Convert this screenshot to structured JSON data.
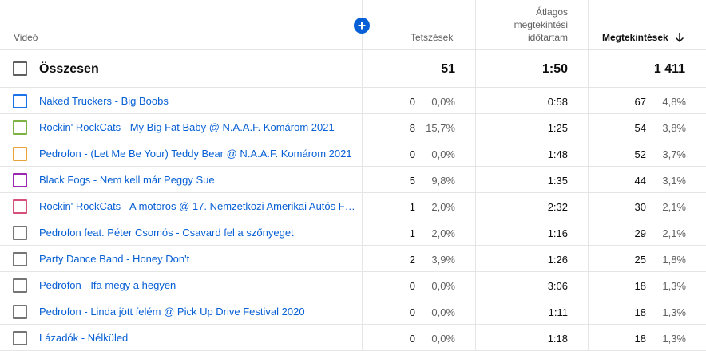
{
  "header": {
    "video_label": "Videó",
    "likes_label": "Tetszések",
    "avg_duration_label_l1": "Átlagos",
    "avg_duration_label_l2": "megtekintési",
    "avg_duration_label_l3": "időtartam",
    "views_label": "Megtekintések",
    "add_icon": "plus-circle-icon",
    "sort_icon": "arrow-down-icon",
    "accent_color": "#065fd4"
  },
  "total": {
    "label": "Összesen",
    "likes": "51",
    "avg_duration": "1:50",
    "views": "1 411"
  },
  "rows": [
    {
      "title": "Naked Truckers - Big Boobs",
      "color": "#1a73e8",
      "likes": "0",
      "likes_pct": "0,0%",
      "avg_duration": "0:58",
      "views": "67",
      "views_pct": "4,8%"
    },
    {
      "title": "Rockin' RockCats - My Big Fat Baby @ N.A.A.F. Komárom 2021",
      "color": "#7cb342",
      "likes": "8",
      "likes_pct": "15,7%",
      "avg_duration": "1:25",
      "views": "54",
      "views_pct": "3,8%"
    },
    {
      "title": "Pedrofon - (Let Me Be Your) Teddy Bear @ N.A.A.F. Komárom 2021",
      "color": "#e8a33d",
      "likes": "0",
      "likes_pct": "0,0%",
      "avg_duration": "1:48",
      "views": "52",
      "views_pct": "3,7%"
    },
    {
      "title": "Black Fogs - Nem kell már Peggy Sue",
      "color": "#9c27b0",
      "likes": "5",
      "likes_pct": "9,8%",
      "avg_duration": "1:35",
      "views": "44",
      "views_pct": "3,1%"
    },
    {
      "title": "Rockin' RockCats - A motoros @ 17. Nemzetközi Amerikai Autós Fe...",
      "color": "#d6507a",
      "likes": "1",
      "likes_pct": "2,0%",
      "avg_duration": "2:32",
      "views": "30",
      "views_pct": "2,1%"
    },
    {
      "title": "Pedrofon feat. Péter Csomós - Csavard fel a szőnyeget",
      "color": "#757575",
      "likes": "1",
      "likes_pct": "2,0%",
      "avg_duration": "1:16",
      "views": "29",
      "views_pct": "2,1%"
    },
    {
      "title": "Party Dance Band - Honey Don't",
      "color": "#757575",
      "likes": "2",
      "likes_pct": "3,9%",
      "avg_duration": "1:26",
      "views": "25",
      "views_pct": "1,8%"
    },
    {
      "title": "Pedrofon - Ifa megy a hegyen",
      "color": "#757575",
      "likes": "0",
      "likes_pct": "0,0%",
      "avg_duration": "3:06",
      "views": "18",
      "views_pct": "1,3%"
    },
    {
      "title": "Pedrofon - Linda jött felém @ Pick Up Drive Festival 2020",
      "color": "#757575",
      "likes": "0",
      "likes_pct": "0,0%",
      "avg_duration": "1:11",
      "views": "18",
      "views_pct": "1,3%"
    },
    {
      "title": "Lázadók - Nélküled",
      "color": "#757575",
      "likes": "0",
      "likes_pct": "0,0%",
      "avg_duration": "1:18",
      "views": "18",
      "views_pct": "1,3%"
    }
  ]
}
